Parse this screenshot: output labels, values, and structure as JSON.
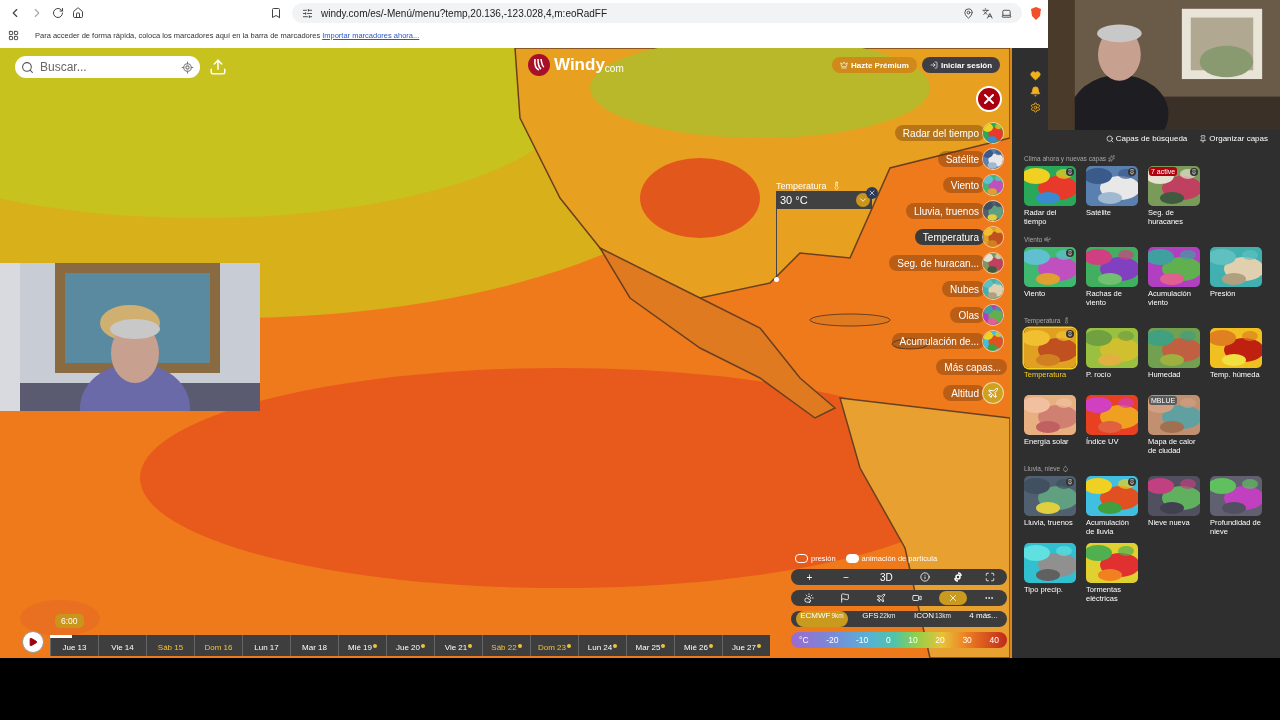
{
  "browser": {
    "url": "windy.com/es/-Menú/menu?temp,20.136,-123.028,4,m:eoRadFF",
    "bookmarks_hint": "Para acceder de forma rápida, coloca los marcadores aquí en la barra de marcadores",
    "bookmarks_link": "Importar marcadores ahora..."
  },
  "map": {
    "search": {
      "placeholder": "Buscar..."
    },
    "logo": {
      "name": "Windy",
      "suffix": "com"
    },
    "premium_button": "Hazte Prémium",
    "login_button": "Iniciar sesión",
    "layers": [
      {
        "label": "Radar del tiempo",
        "kind": "map",
        "selected": false
      },
      {
        "label": "Satélite",
        "kind": "map",
        "selected": false
      },
      {
        "label": "Viento",
        "kind": "map",
        "selected": false
      },
      {
        "label": "Lluvia, truenos",
        "kind": "map",
        "selected": false
      },
      {
        "label": "Temperatura",
        "kind": "map",
        "selected": true
      },
      {
        "label": "Seg. de huracan...",
        "kind": "map",
        "selected": false
      },
      {
        "label": "Nubes",
        "kind": "map",
        "selected": false
      },
      {
        "label": "Olas",
        "kind": "map",
        "selected": false
      },
      {
        "label": "Acumulación de...",
        "kind": "map",
        "selected": false
      },
      {
        "label": "Más capas...",
        "kind": "more",
        "selected": false
      },
      {
        "label": "Altitud",
        "kind": "plane",
        "selected": false
      }
    ],
    "picker": {
      "title": "Temperatura",
      "value": "30 °C"
    },
    "toggles": [
      {
        "label": "presión",
        "on": false
      },
      {
        "label": "animación de partícula",
        "on": true
      }
    ],
    "zoom_row": {
      "plus": "+",
      "minus": "−",
      "view": "3D"
    },
    "tools": [
      {
        "kind": "weather",
        "selected": false
      },
      {
        "kind": "flag",
        "selected": false
      },
      {
        "kind": "plane",
        "selected": false
      },
      {
        "kind": "video",
        "selected": false
      },
      {
        "kind": "close",
        "selected": true
      },
      {
        "kind": "more",
        "selected": false
      }
    ],
    "models": [
      {
        "name": "ECMWF",
        "resolution": "9km",
        "selected": true
      },
      {
        "name": "GFS",
        "resolution": "22km",
        "selected": false
      },
      {
        "name": "ICON",
        "resolution": "13km",
        "selected": false
      },
      {
        "name": "4 más...",
        "selected": false
      }
    ],
    "legend": {
      "unit": "°C",
      "values": [
        "-20",
        "-10",
        "0",
        "10",
        "20",
        "30",
        "40"
      ]
    },
    "timeline": {
      "time": "6:00",
      "level": 0.03,
      "days": [
        {
          "label": "Jue 13",
          "weekend": false,
          "dot": false
        },
        {
          "label": "Vie 14",
          "weekend": false,
          "dot": false
        },
        {
          "label": "Sáb 15",
          "weekend": true,
          "dot": false
        },
        {
          "label": "Dom 16",
          "weekend": true,
          "dot": false
        },
        {
          "label": "Lun 17",
          "weekend": false,
          "dot": false
        },
        {
          "label": "Mar 18",
          "weekend": false,
          "dot": false
        },
        {
          "label": "Mié 19",
          "weekend": false,
          "dot": true
        },
        {
          "label": "Jue 20",
          "weekend": false,
          "dot": true
        },
        {
          "label": "Vie 21",
          "weekend": false,
          "dot": true
        },
        {
          "label": "Sáb 22",
          "weekend": true,
          "dot": true
        },
        {
          "label": "Dom 23",
          "weekend": true,
          "dot": true
        },
        {
          "label": "Lun 24",
          "weekend": false,
          "dot": true
        },
        {
          "label": "Mar 25",
          "weekend": false,
          "dot": true
        },
        {
          "label": "Mié 26",
          "weekend": false,
          "dot": true
        },
        {
          "label": "Jue 27",
          "weekend": false,
          "dot": true
        }
      ]
    }
  },
  "panel": {
    "actions": [
      {
        "label": "Capas de búsqueda",
        "kind": "search"
      },
      {
        "label": "Organizar capas",
        "kind": "pin"
      }
    ],
    "sections": [
      {
        "title": "Clima ahora y nuevas capas",
        "kind": "new",
        "layers": [
          {
            "label": "Radar del tiempo",
            "selected": false,
            "pinned": true
          },
          {
            "label": "Satélite",
            "selected": false,
            "pinned": true
          },
          {
            "label": "Seg. de huracanes",
            "selected": false,
            "pinned": true,
            "badge": {
              "text": "7 active",
              "color": "#b3000f"
            }
          }
        ]
      },
      {
        "title": "Viento",
        "kind": "wind",
        "layers": [
          {
            "label": "Viento",
            "selected": false,
            "pinned": true
          },
          {
            "label": "Rachas de viento",
            "selected": false,
            "pinned": false
          },
          {
            "label": "Acumulación viento",
            "selected": false,
            "pinned": false
          },
          {
            "label": "Presión",
            "selected": false,
            "pinned": false
          }
        ]
      },
      {
        "title": "Temperatura",
        "kind": "temp",
        "layers": [
          {
            "label": "Temperatura",
            "selected": true,
            "pinned": true
          },
          {
            "label": "P. rocío",
            "selected": false,
            "pinned": false
          },
          {
            "label": "Humedad",
            "selected": false,
            "pinned": false
          },
          {
            "label": "Temp. húmeda",
            "selected": false,
            "pinned": false
          },
          {
            "label": "Energía solar",
            "selected": false,
            "pinned": false
          },
          {
            "label": "Índice UV",
            "selected": false,
            "pinned": false
          },
          {
            "label": "Mapa de calor de ciudad",
            "selected": false,
            "pinned": false,
            "badge": {
              "text": "MBLUE",
              "color": "#5a5a5a"
            }
          }
        ]
      },
      {
        "title": "Lluvia, nieve",
        "kind": "rain",
        "layers": [
          {
            "label": "Lluvia, truenos",
            "selected": false,
            "pinned": true
          },
          {
            "label": "Acumulación de lluvia",
            "selected": false,
            "pinned": true
          },
          {
            "label": "Nieve nueva",
            "selected": false,
            "pinned": false
          },
          {
            "label": "Profundidad de nieve",
            "selected": false,
            "pinned": false
          },
          {
            "label": "Tipo precip.",
            "selected": false,
            "pinned": false
          },
          {
            "label": "Tormentas eléctricas",
            "selected": false,
            "pinned": false
          }
        ]
      }
    ]
  }
}
